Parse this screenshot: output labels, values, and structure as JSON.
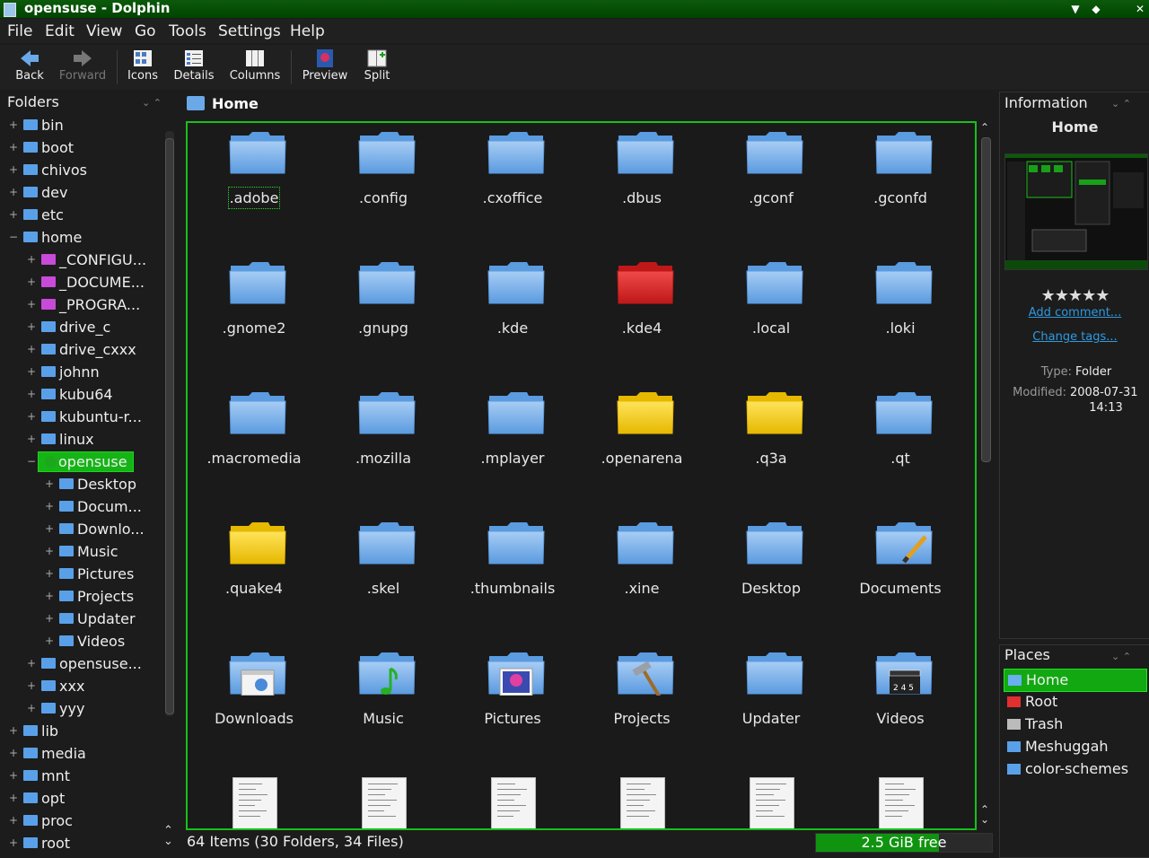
{
  "window": {
    "title": "opensuse - Dolphin"
  },
  "menu": [
    "File",
    "Edit",
    "View",
    "Go",
    "Tools",
    "Settings",
    "Help"
  ],
  "toolbar": {
    "back": "Back",
    "forward": "Forward",
    "icons": "Icons",
    "details": "Details",
    "columns": "Columns",
    "preview": "Preview",
    "split": "Split"
  },
  "folders_panel": {
    "title": "Folders",
    "items": [
      {
        "label": "bin",
        "expander": "+",
        "indent": 0,
        "color": "#5aa0e8"
      },
      {
        "label": "boot",
        "expander": "+",
        "indent": 0,
        "color": "#5aa0e8"
      },
      {
        "label": "chivos",
        "expander": "+",
        "indent": 0,
        "color": "#5aa0e8"
      },
      {
        "label": "dev",
        "expander": "+",
        "indent": 0,
        "color": "#5aa0e8"
      },
      {
        "label": "etc",
        "expander": "+",
        "indent": 0,
        "color": "#5aa0e8"
      },
      {
        "label": "home",
        "expander": "−",
        "indent": 0,
        "color": "#5aa0e8"
      },
      {
        "label": "_CONFIGU...",
        "expander": "+",
        "indent": 1,
        "color": "#c84ad8"
      },
      {
        "label": "_DOCUME...",
        "expander": "+",
        "indent": 1,
        "color": "#c84ad8"
      },
      {
        "label": "_PROGRA...",
        "expander": "+",
        "indent": 1,
        "color": "#c84ad8"
      },
      {
        "label": "drive_c",
        "expander": "+",
        "indent": 1,
        "color": "#5aa0e8"
      },
      {
        "label": "drive_cxxx",
        "expander": "+",
        "indent": 1,
        "color": "#5aa0e8"
      },
      {
        "label": "johnn",
        "expander": "+",
        "indent": 1,
        "color": "#5aa0e8"
      },
      {
        "label": "kubu64",
        "expander": "+",
        "indent": 1,
        "color": "#5aa0e8"
      },
      {
        "label": "kubuntu-r...",
        "expander": "+",
        "indent": 1,
        "color": "#5aa0e8"
      },
      {
        "label": "linux",
        "expander": "+",
        "indent": 1,
        "color": "#5aa0e8"
      },
      {
        "label": "opensuse",
        "expander": "−",
        "indent": 1,
        "color": "#1ca81c",
        "selected": true
      },
      {
        "label": "Desktop",
        "expander": "+",
        "indent": 2,
        "color": "#5aa0e8"
      },
      {
        "label": "Docum...",
        "expander": "+",
        "indent": 2,
        "color": "#5aa0e8"
      },
      {
        "label": "Downlo...",
        "expander": "+",
        "indent": 2,
        "color": "#5aa0e8"
      },
      {
        "label": "Music",
        "expander": "+",
        "indent": 2,
        "color": "#5aa0e8"
      },
      {
        "label": "Pictures",
        "expander": "+",
        "indent": 2,
        "color": "#5aa0e8"
      },
      {
        "label": "Projects",
        "expander": "+",
        "indent": 2,
        "color": "#5aa0e8"
      },
      {
        "label": "Updater",
        "expander": "+",
        "indent": 2,
        "color": "#5aa0e8"
      },
      {
        "label": "Videos",
        "expander": "+",
        "indent": 2,
        "color": "#5aa0e8"
      },
      {
        "label": "opensuse...",
        "expander": "+",
        "indent": 1,
        "color": "#5aa0e8"
      },
      {
        "label": "xxx",
        "expander": "+",
        "indent": 1,
        "color": "#5aa0e8"
      },
      {
        "label": "yyy",
        "expander": "+",
        "indent": 1,
        "color": "#5aa0e8"
      },
      {
        "label": "lib",
        "expander": "+",
        "indent": 0,
        "color": "#5aa0e8"
      },
      {
        "label": "media",
        "expander": "+",
        "indent": 0,
        "color": "#5aa0e8"
      },
      {
        "label": "mnt",
        "expander": "+",
        "indent": 0,
        "color": "#5aa0e8"
      },
      {
        "label": "opt",
        "expander": "+",
        "indent": 0,
        "color": "#5aa0e8"
      },
      {
        "label": "proc",
        "expander": "+",
        "indent": 0,
        "color": "#5aa0e8"
      },
      {
        "label": "root",
        "expander": "+",
        "indent": 0,
        "color": "#5aa0e8"
      }
    ]
  },
  "location": {
    "title": "Home"
  },
  "files": [
    {
      "name": ".adobe",
      "kind": "folder",
      "color": "blue",
      "focus": true
    },
    {
      "name": ".config",
      "kind": "folder",
      "color": "blue"
    },
    {
      "name": ".cxoffice",
      "kind": "folder",
      "color": "blue"
    },
    {
      "name": ".dbus",
      "kind": "folder",
      "color": "blue"
    },
    {
      "name": ".gconf",
      "kind": "folder",
      "color": "blue"
    },
    {
      "name": ".gconfd",
      "kind": "folder",
      "color": "blue"
    },
    {
      "name": ".gnome2",
      "kind": "folder",
      "color": "blue"
    },
    {
      "name": ".gnupg",
      "kind": "folder",
      "color": "blue"
    },
    {
      "name": ".kde",
      "kind": "folder",
      "color": "blue"
    },
    {
      "name": ".kde4",
      "kind": "folder",
      "color": "red"
    },
    {
      "name": ".local",
      "kind": "folder",
      "color": "blue"
    },
    {
      "name": ".loki",
      "kind": "folder",
      "color": "blue"
    },
    {
      "name": ".macromedia",
      "kind": "folder",
      "color": "blue"
    },
    {
      "name": ".mozilla",
      "kind": "folder",
      "color": "blue"
    },
    {
      "name": ".mplayer",
      "kind": "folder",
      "color": "blue"
    },
    {
      "name": ".openarena",
      "kind": "folder",
      "color": "yellow"
    },
    {
      "name": ".q3a",
      "kind": "folder",
      "color": "yellow"
    },
    {
      "name": ".qt",
      "kind": "folder",
      "color": "blue"
    },
    {
      "name": ".quake4",
      "kind": "folder",
      "color": "yellow"
    },
    {
      "name": ".skel",
      "kind": "folder",
      "color": "blue"
    },
    {
      "name": ".thumbnails",
      "kind": "folder",
      "color": "blue"
    },
    {
      "name": ".xine",
      "kind": "folder",
      "color": "blue"
    },
    {
      "name": "Desktop",
      "kind": "folder",
      "color": "blue"
    },
    {
      "name": "Documents",
      "kind": "folder",
      "color": "blue",
      "emblem": "pencil"
    },
    {
      "name": "Downloads",
      "kind": "folder",
      "color": "blue",
      "emblem": "window"
    },
    {
      "name": "Music",
      "kind": "folder",
      "color": "blue",
      "emblem": "note"
    },
    {
      "name": "Pictures",
      "kind": "folder",
      "color": "blue",
      "emblem": "picture"
    },
    {
      "name": "Projects",
      "kind": "folder",
      "color": "blue",
      "emblem": "hammer"
    },
    {
      "name": "Updater",
      "kind": "folder",
      "color": "blue"
    },
    {
      "name": "Videos",
      "kind": "folder",
      "color": "blue",
      "emblem": "clapper"
    },
    {
      "name": "",
      "kind": "doc"
    },
    {
      "name": "",
      "kind": "doc"
    },
    {
      "name": "",
      "kind": "doc"
    },
    {
      "name": "",
      "kind": "doc"
    },
    {
      "name": "",
      "kind": "doc"
    },
    {
      "name": "",
      "kind": "doc"
    }
  ],
  "status": {
    "text": "64 Items (30 Folders, 34 Files)",
    "free": "2.5 GiB free",
    "used_fraction": 0.7
  },
  "information": {
    "title": "Information",
    "heading": "Home",
    "rating_stars": "★★★★★",
    "add_comment": "Add comment...",
    "change_tags": "Change tags...",
    "type_label": "Type:",
    "type_value": "Folder",
    "modified_label": "Modified:",
    "modified_date": "2008-07-31",
    "modified_time": "14:13"
  },
  "places": {
    "title": "Places",
    "items": [
      {
        "label": "Home",
        "color": "#6ab0f0",
        "selected": true
      },
      {
        "label": "Root",
        "color": "#e23030"
      },
      {
        "label": "Trash",
        "color": "#bbbbbb"
      },
      {
        "label": "Meshuggah",
        "color": "#5aa0e8"
      },
      {
        "label": "color-schemes",
        "color": "#5aa0e8"
      }
    ]
  },
  "colors": {
    "accent": "#18c018",
    "titlebar": "#0c5a0c",
    "link": "#2e9ae0"
  }
}
